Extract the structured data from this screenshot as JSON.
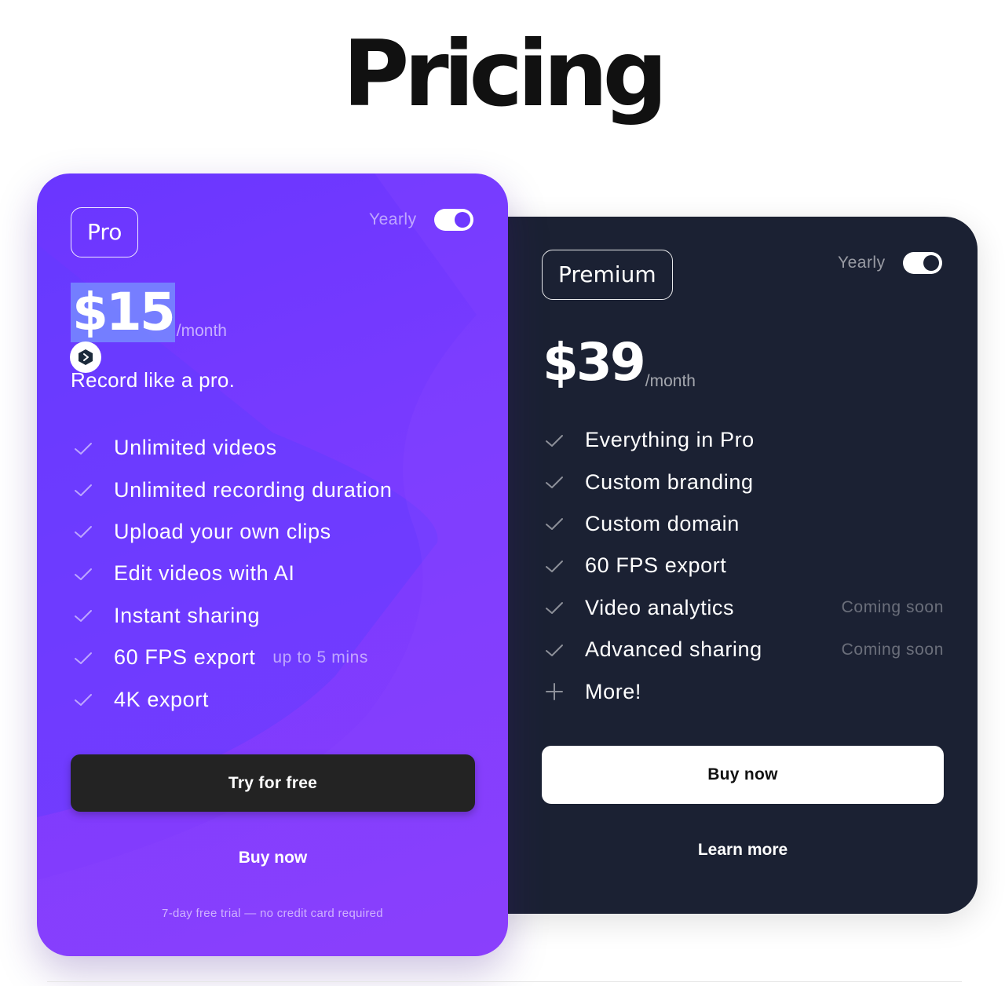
{
  "page": {
    "title": "Pricing"
  },
  "plans": {
    "pro": {
      "name": "Pro",
      "billing_toggle_label": "Yearly",
      "billing_yearly_on": true,
      "price": "$15",
      "period": "/month",
      "tagline": "Record like a pro.",
      "features": [
        {
          "text": "Unlimited videos",
          "icon": "check-icon"
        },
        {
          "text": "Unlimited recording duration",
          "icon": "check-icon"
        },
        {
          "text": "Upload your own clips",
          "icon": "check-icon"
        },
        {
          "text": "Edit videos with AI",
          "icon": "check-icon"
        },
        {
          "text": "Instant sharing",
          "icon": "check-icon"
        },
        {
          "text": "60 FPS export",
          "note": "up to 5 mins",
          "icon": "check-icon"
        },
        {
          "text": "4K export",
          "icon": "check-icon"
        }
      ],
      "primary_cta": "Try for free",
      "secondary_cta": "Buy now",
      "footnote": "7-day free trial — no credit card required"
    },
    "premium": {
      "name": "Premium",
      "billing_toggle_label": "Yearly",
      "billing_yearly_on": true,
      "price": "$39",
      "period": "/month",
      "features": [
        {
          "text": "Everything in Pro",
          "icon": "check-icon"
        },
        {
          "text": "Custom branding",
          "icon": "check-icon"
        },
        {
          "text": "Custom domain",
          "icon": "check-icon"
        },
        {
          "text": "60 FPS export",
          "icon": "check-icon"
        },
        {
          "text": "Video analytics",
          "note": "Coming soon",
          "icon": "check-icon"
        },
        {
          "text": "Advanced sharing",
          "note": "Coming soon",
          "icon": "check-icon"
        },
        {
          "text": "More!",
          "icon": "plus-icon"
        }
      ],
      "primary_cta": "Buy now",
      "secondary_cta": "Learn more"
    }
  },
  "colors": {
    "pro_card": "#6e39ff",
    "premium_card": "#1b2133",
    "dark_button": "#232323",
    "selection_highlight": "#7896ff"
  },
  "overlay_icon": "extension-logo-icon"
}
